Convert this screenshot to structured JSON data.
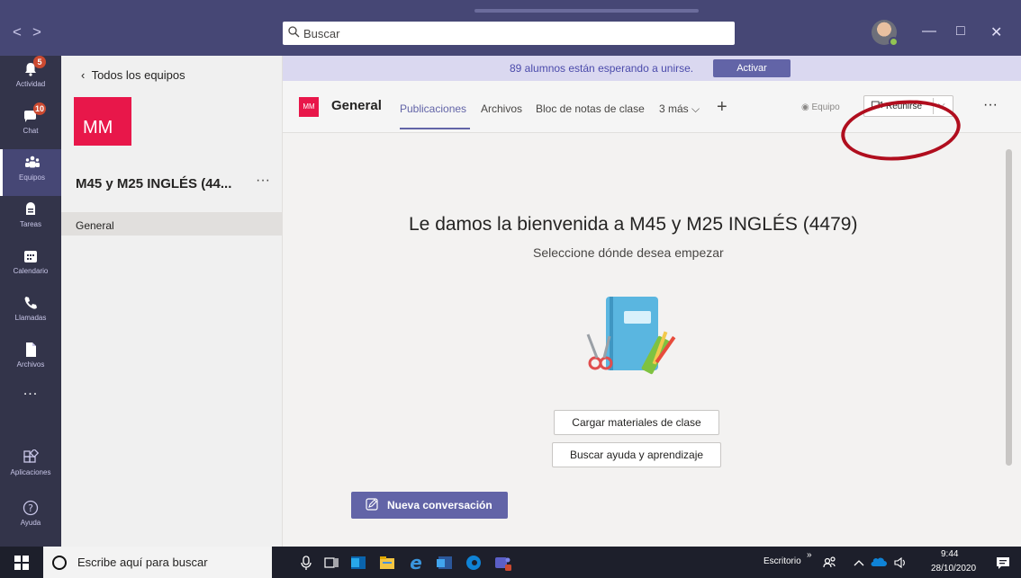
{
  "titlebar": {
    "nav_back": "<",
    "nav_forward": ">",
    "search_placeholder": "Buscar",
    "minimize": "—",
    "maximize": "□",
    "close": "✕"
  },
  "rail": {
    "items": [
      {
        "label": "Actividad",
        "badge": "5"
      },
      {
        "label": "Chat",
        "badge": "10"
      },
      {
        "label": "Equipos",
        "badge": ""
      },
      {
        "label": "Tareas",
        "badge": ""
      },
      {
        "label": "Calendario",
        "badge": ""
      },
      {
        "label": "Llamadas",
        "badge": ""
      },
      {
        "label": "Archivos",
        "badge": ""
      },
      {
        "label": "...",
        "badge": ""
      },
      {
        "label": "Aplicaciones",
        "badge": ""
      },
      {
        "label": "Ayuda",
        "badge": ""
      }
    ]
  },
  "teams_panel": {
    "back_label": "Todos los equipos",
    "team_initials": "MM",
    "team_name": "M45 y M25 INGLÉS (44...",
    "more": "···",
    "channel": "General"
  },
  "banner": {
    "text": "89 alumnos están esperando a unirse.",
    "button": "Activar"
  },
  "channel_header": {
    "initials": "MM",
    "name": "General",
    "tabs": [
      "Publicaciones",
      "Archivos",
      "Bloc de notas de clase",
      "3 más ⌵"
    ],
    "add": "+",
    "team_label": "Equipo",
    "meet_button": "Reunirse",
    "more": "···"
  },
  "welcome": {
    "title": "Le damos la bienvenida a M45 y M25 INGLÉS (4479)",
    "subtitle": "Seleccione dónde desea empezar",
    "buttons": [
      "Cargar materiales de clase",
      "Buscar ayuda y aprendizaje"
    ]
  },
  "composer": {
    "new_conversation": "Nueva conversación"
  },
  "taskbar": {
    "search_placeholder": "Escribe aquí para buscar",
    "desktop_label": "Escritorio",
    "chevron": "»",
    "time": "9:44",
    "date": "28/10/2020"
  },
  "colors": {
    "brand": "#464775",
    "accent": "#6264a7",
    "team_tile": "#e8174a",
    "annotation": "#b00e1e"
  }
}
